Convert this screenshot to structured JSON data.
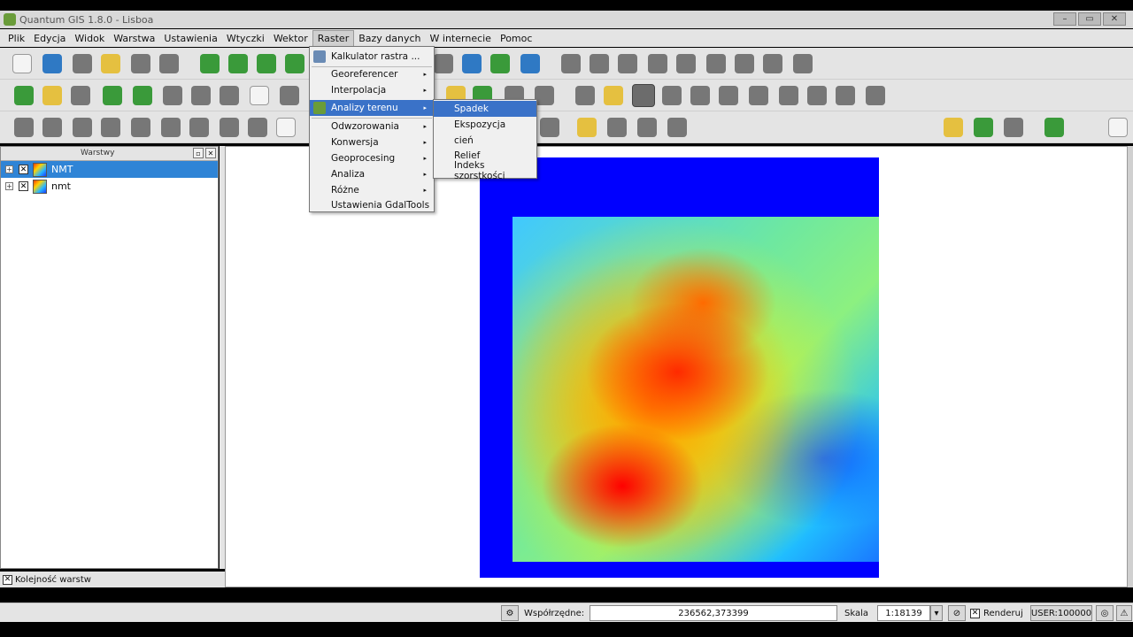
{
  "window": {
    "title": "Quantum GIS 1.8.0 - Lisboa"
  },
  "menubar": [
    "Plik",
    "Edycja",
    "Widok",
    "Warstwa",
    "Ustawienia",
    "Wtyczki",
    "Wektor",
    "Raster",
    "Bazy danych",
    "W internecie",
    "Pomoc"
  ],
  "raster_menu": {
    "items": [
      "Kalkulator rastra ...",
      "Georeferencer",
      "Interpolacja",
      "Analizy terenu",
      "Odwzorowania",
      "Konwersja",
      "Geoprocesing",
      "Analiza",
      "Różne",
      "Ustawienia GdalTools"
    ],
    "highlighted": "Analizy terenu"
  },
  "terrain_submenu": {
    "items": [
      "Spadek",
      "Ekspozycja",
      "cień",
      "Relief",
      "Indeks szorstkości"
    ],
    "highlighted": "Spadek"
  },
  "layers_panel": {
    "title": "Warstwy",
    "layers": [
      {
        "name": "NMT",
        "checked": "✕",
        "selected": true
      },
      {
        "name": "nmt",
        "checked": "✕",
        "selected": false
      }
    ],
    "order_label": "Kolejność warstw",
    "order_checked": "✕"
  },
  "statusbar": {
    "coords_label": "Współrzędne:",
    "coords_value": "236562,373399",
    "scale_label": "Skala",
    "scale_value": "1:18139",
    "render_label": "Renderuj",
    "render_checked": "✕",
    "crs": "USER:100000"
  },
  "colors": {
    "menu_highlight": "#3a72c8",
    "layer_selected": "#2f84d6",
    "raster_nodata": "#0000ff"
  }
}
